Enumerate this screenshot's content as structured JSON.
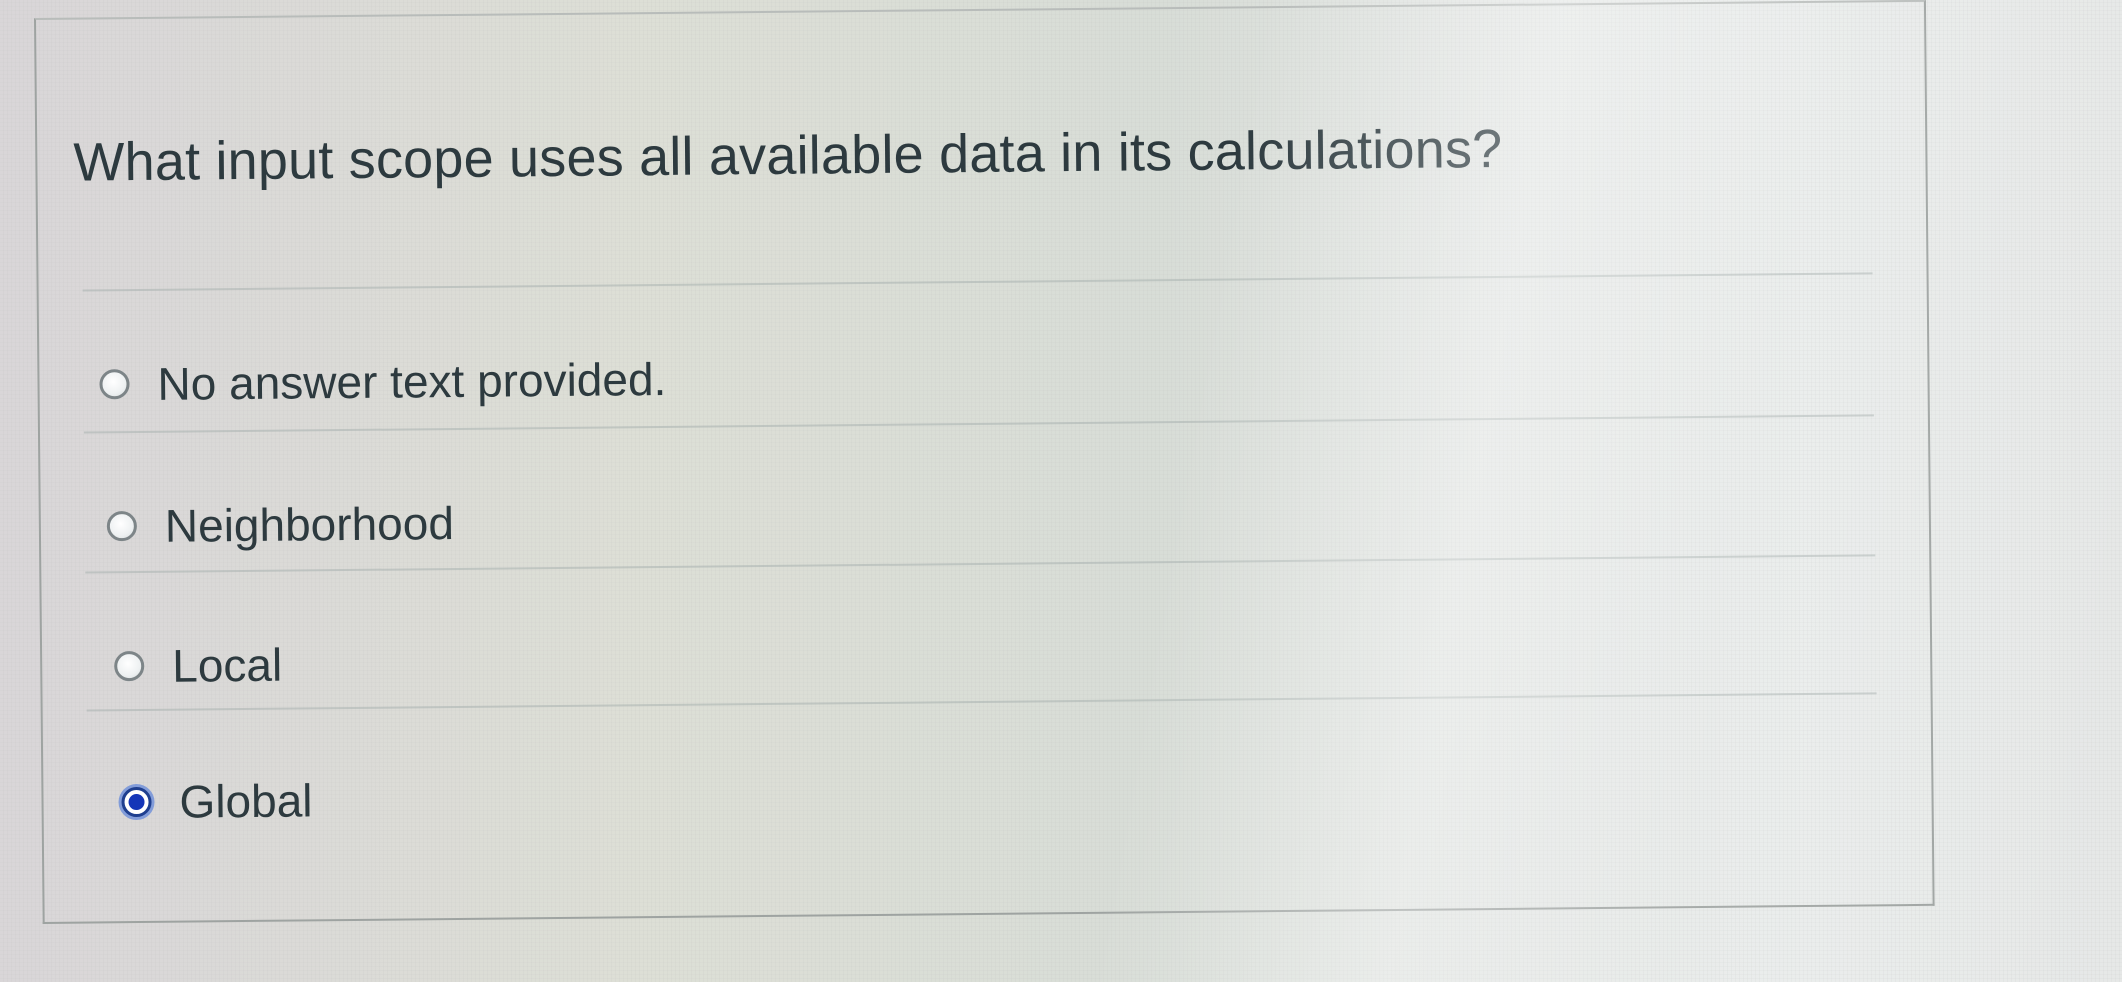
{
  "question": {
    "text": "What input scope uses all available data in its calculations?"
  },
  "answers": [
    {
      "label": "No answer text provided.",
      "selected": false
    },
    {
      "label": "Neighborhood",
      "selected": false
    },
    {
      "label": "Local",
      "selected": false
    },
    {
      "label": "Global",
      "selected": true
    }
  ],
  "colors": {
    "text": "#2d3a3f",
    "selected_radio": "#1536b8",
    "card_border": "#9ea3a1"
  }
}
